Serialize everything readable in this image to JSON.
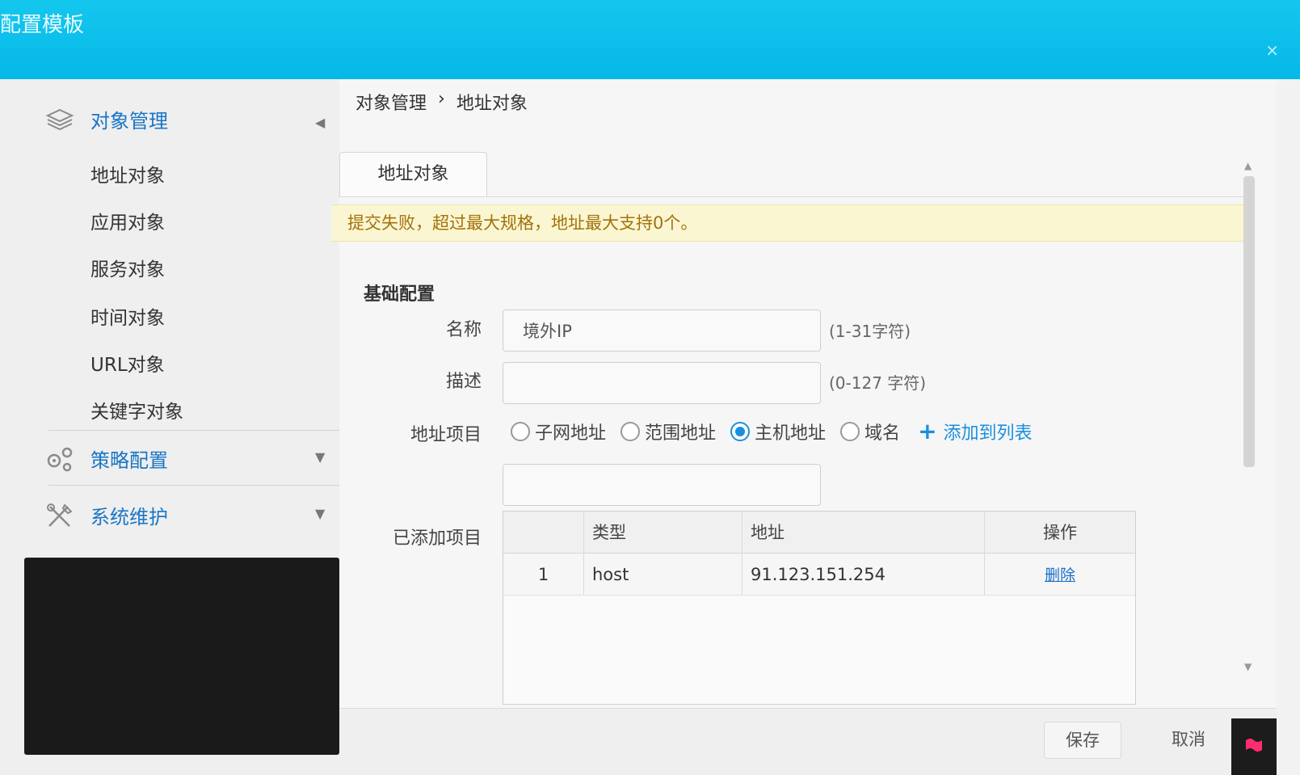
{
  "window": {
    "title": "配置模板",
    "close_glyph": "×"
  },
  "sidebar": {
    "groups": [
      {
        "label": "对象管理",
        "icon": "layers-icon",
        "expanded": true,
        "items": [
          "地址对象",
          "应用对象",
          "服务对象",
          "时间对象",
          "URL对象",
          "关键字对象"
        ]
      },
      {
        "label": "策略配置",
        "icon": "gears-icon",
        "expanded": false
      },
      {
        "label": "系统维护",
        "icon": "tools-icon",
        "expanded": false
      }
    ]
  },
  "breadcrumb": {
    "parent": "对象管理",
    "separator": "›",
    "current": "地址对象"
  },
  "tab": {
    "label": "地址对象"
  },
  "alert": {
    "message": "提交失败，超过最大规格，地址最大支持0个。"
  },
  "form": {
    "section_title": "基础配置",
    "name": {
      "label": "名称",
      "value": "境外IP",
      "hint": "(1-31字符)"
    },
    "description": {
      "label": "描述",
      "value": "",
      "hint": "(0-127 字符)"
    },
    "address_item": {
      "label": "地址项目",
      "options": [
        "子网地址",
        "范围地址",
        "主机地址",
        "域名"
      ],
      "selected": "主机地址",
      "add_link": "添加到列表",
      "input_value": ""
    },
    "added_items": {
      "label": "已添加项目",
      "columns": [
        "",
        "类型",
        "地址",
        "操作"
      ],
      "rows": [
        {
          "no": "1",
          "type": "host",
          "address": "91.123.151.254",
          "action": "删除"
        }
      ]
    }
  },
  "footer": {
    "save_label": "保存",
    "cancel_label": "取消"
  },
  "colors": {
    "titlebar": "#06b8e8",
    "accent": "#1a8fe0",
    "alert_bg": "#fbf6d2",
    "alert_text": "#a3720c"
  }
}
